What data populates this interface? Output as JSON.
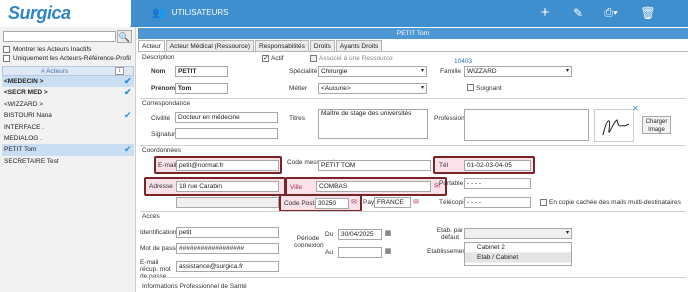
{
  "app": {
    "logo": "Surgica",
    "section_title": "UTILISATEURS"
  },
  "left": {
    "show_inactive": "Montrer les Acteurs Inactifs",
    "only_ref": "Uniquement les Acteurs-Référence-Profil",
    "list_header": "# Acteurs",
    "actors": [
      {
        "name": "<MEDECIN >",
        "bold": true,
        "tick": true,
        "selected": true
      },
      {
        "name": "<SECR MED >",
        "bold": true,
        "tick": true,
        "selected": false
      },
      {
        "name": "<WIZZARD >",
        "bold": false,
        "tick": false,
        "selected": false
      },
      {
        "name": "BISTOURI Nana",
        "bold": false,
        "tick": true,
        "selected": false
      },
      {
        "name": "INTERFACE .",
        "bold": false,
        "tick": false,
        "selected": false
      },
      {
        "name": "MEDIALOG .",
        "bold": false,
        "tick": false,
        "selected": false
      },
      {
        "name": "PETIT Tom",
        "bold": false,
        "tick": true,
        "selected": true
      },
      {
        "name": "SECRETAIRE Test",
        "bold": false,
        "tick": false,
        "selected": false
      }
    ]
  },
  "titlebar": "PETIT Tom",
  "tabs": [
    "Acteur",
    "Acteur Médical (Ressource)",
    "Responsabilités",
    "Droits",
    "Ayants Droits"
  ],
  "description": {
    "section": "Description",
    "actif": "Actif",
    "associe": "Associé à une Ressource",
    "id": "10403",
    "nom_label": "Nom",
    "nom": "PETIT",
    "prenom_label": "Prénom",
    "prenom": "Tom",
    "specialite_label": "Spécialité",
    "specialite": "Chirurgie",
    "metier_label": "Métier",
    "metier": "<Aucune>",
    "famille_label": "Famille",
    "famille": "WIZZARD",
    "soignant": "Soignant"
  },
  "correspondance": {
    "section": "Correspondance",
    "civilite_label": "Civilité",
    "civilite": "Docteur en médecine",
    "titres_label": "Titres",
    "titres": "Maître de stage des universités",
    "profession_label": "Profession",
    "signature_label": "Signature",
    "charger_image": "Charger Image"
  },
  "coordonnees": {
    "section": "Coordonnées",
    "email_label": "E-mail",
    "email": "petit@normal.fr",
    "code_msg_label": "Code messagerie",
    "code_msg": "PETIT TOM",
    "tel_label": "Tél",
    "tel": "01-02-03-04-05",
    "adresse_label": "Adresse",
    "adresse": "18 rue Carabin",
    "ville_label": "Ville",
    "ville": "COMBAS",
    "portable_label": "Portable",
    "portable": "- - - -",
    "cp_label": "Code Postal",
    "cp": "30250",
    "pays_label": "Pays",
    "pays": "FRANCE",
    "telecopie_label": "Télécopie",
    "telecopie": "- - - -",
    "copie_cachee": "En copie cachée des mails multi-destinataires"
  },
  "acces": {
    "section": "Accès",
    "ident_label": "Identification",
    "ident": "petit",
    "mdp_label": "Mot de passe",
    "mdp": "##################",
    "email_recup_label": "E-mail récup. mot de passe",
    "email_recup": "assistance@surgica.fr",
    "periode_label": "Période connexion",
    "du_label": "Du",
    "du": "30/04/2025",
    "au_label": "Au",
    "au": "",
    "etab_defaut_label": "Etab. par défaut",
    "etablissements_label": "Etablissements",
    "etablissements": [
      "Cabinet 2",
      "Etab / Cabinet"
    ]
  },
  "footer_section": "Informations Professionnel de Santé"
}
